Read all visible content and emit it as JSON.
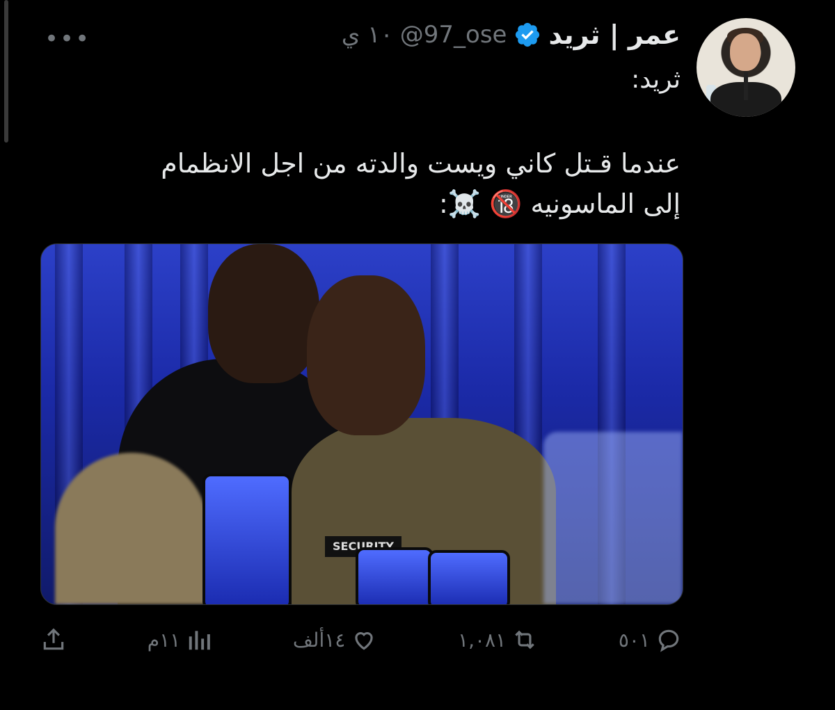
{
  "tweet": {
    "display_name": "عمر | ثريد",
    "handle": "@97_ose",
    "time": "١٠ ي",
    "more": "•••",
    "label": "ثريد:",
    "text_line1": "عندما قـتل  كاني ويست والدته من اجل الانظمام",
    "text_line2": "إلى الماسونيه 🔞 ☠️:",
    "media": {
      "vest_text": "SECURITY",
      "dominant_colors": [
        "#2c40c8",
        "#0d0d10",
        "#5a5036"
      ]
    },
    "actions": {
      "replies": "٥٠١",
      "retweets": "١,٠٨١",
      "likes": "١٤ألف",
      "views": "١١م"
    }
  },
  "colors": {
    "background": "#000000",
    "text": "#e7e9ea",
    "muted": "#71767b",
    "verified": "#1d9bf0"
  }
}
